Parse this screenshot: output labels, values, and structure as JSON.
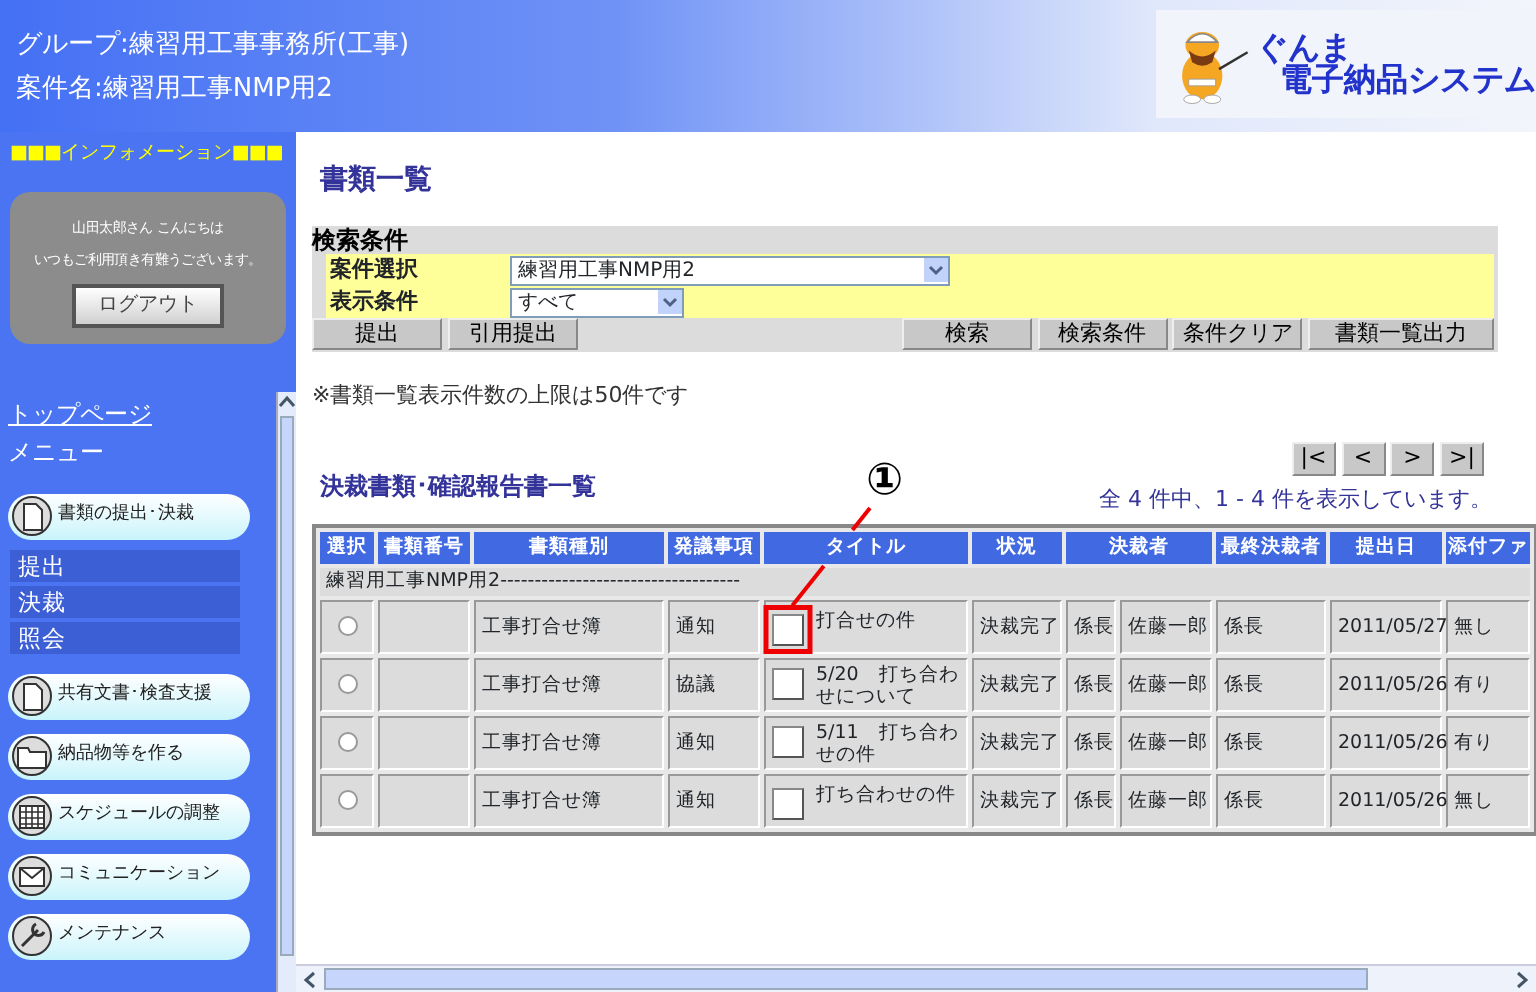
{
  "header": {
    "group": "グループ:練習用工事事務所(工事)",
    "case": "案件名:練習用工事NMP用2",
    "logo": {
      "line1": "ぐんま",
      "line2": "電子納品システム"
    }
  },
  "sidebar": {
    "info_heading": "■■■インフォメーション■■■",
    "greeting": [
      "山田太郎さん こんにちは",
      "いつもご利用頂き有難うございます。"
    ],
    "logout_button": "ログアウト",
    "top_link": "トップページ",
    "menu_label": "メニュー",
    "menu": [
      {
        "label": "書類の提出･決裁",
        "kind": "document",
        "children": [
          {
            "label": "提出"
          },
          {
            "label": "決裁"
          },
          {
            "label": "照会"
          }
        ]
      },
      {
        "label": "共有文書･検査支援",
        "kind": "document"
      },
      {
        "label": "納品物等を作る",
        "kind": "folder"
      },
      {
        "label": "スケジュールの調整",
        "kind": "calendar"
      },
      {
        "label": "コミュニケーション",
        "kind": "mail"
      },
      {
        "label": "メンテナンス",
        "kind": "tools"
      }
    ]
  },
  "main": {
    "title": "書類一覧",
    "search": {
      "title": "検索条件",
      "fields": [
        {
          "label": "案件選択",
          "value": "練習用工事NMP用2"
        },
        {
          "label": "表示条件",
          "value": "すべて"
        }
      ],
      "left_buttons": [
        "提出",
        "引用提出"
      ],
      "right_buttons": [
        "検索",
        "検索条件",
        "条件クリア",
        "書類一覧出力"
      ]
    },
    "note": "※書類一覧表示件数の上限は50件です",
    "list_title": "決裁書類･確認報告書一覧",
    "pager": [
      "|<",
      "<",
      ">",
      ">|"
    ],
    "count": "全 4 件中、1 - 4 件を表示しています。",
    "table": {
      "columns": [
        "選択",
        "書類番号",
        "書類種別",
        "発議事項",
        "タイトル",
        "状況",
        "決裁者",
        "最終決裁者",
        "提出日",
        "添付ファ"
      ],
      "group_row": "練習用工事NMP用2-----------------------------------",
      "rows": [
        {
          "selected": false,
          "number": "",
          "type": "工事打合せ簿",
          "matter": "通知",
          "title": "打合せの件",
          "status": "決裁完了",
          "approver_role": "係長",
          "approver": "佐藤一郎",
          "final_approver": "係長",
          "date": "2011/05/27",
          "attachment": "無し"
        },
        {
          "selected": false,
          "number": "",
          "type": "工事打合せ簿",
          "matter": "協議",
          "title": "5/20　打ち合わせについて",
          "status": "決裁完了",
          "approver_role": "係長",
          "approver": "佐藤一郎",
          "final_approver": "係長",
          "date": "2011/05/26",
          "attachment": "有り"
        },
        {
          "selected": false,
          "number": "",
          "type": "工事打合せ簿",
          "matter": "通知",
          "title": "5/11　打ち合わせの件",
          "status": "決裁完了",
          "approver_role": "係長",
          "approver": "佐藤一郎",
          "final_approver": "係長",
          "date": "2011/05/26",
          "attachment": "有り"
        },
        {
          "selected": false,
          "number": "",
          "type": "工事打合せ簿",
          "matter": "通知",
          "title": "打ち合わせの件",
          "status": "決裁完了",
          "approver_role": "係長",
          "approver": "佐藤一郎",
          "final_approver": "係長",
          "date": "2011/05/26",
          "attachment": "無し"
        }
      ]
    },
    "annotation": "①"
  }
}
